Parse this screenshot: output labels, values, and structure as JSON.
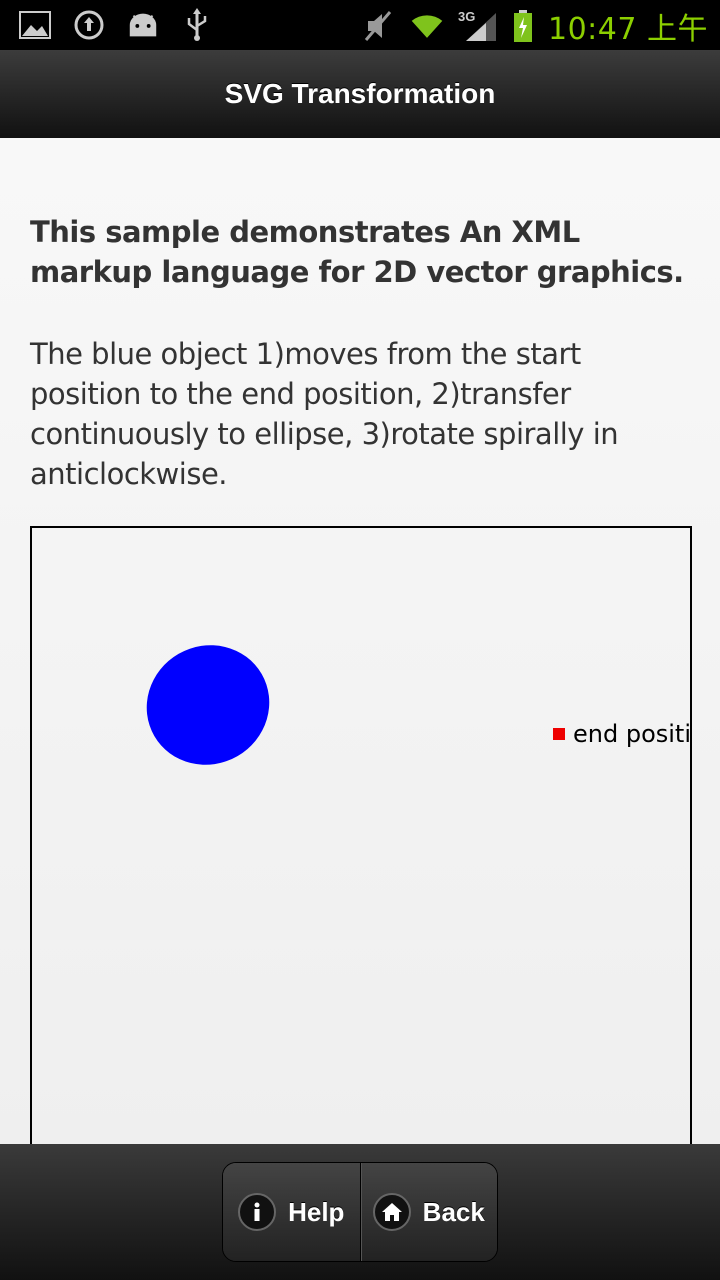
{
  "status_bar": {
    "icons": [
      "image-icon",
      "sync-icon",
      "android-icon",
      "usb-icon",
      "mute-icon",
      "wifi-icon",
      "signal-3g-icon",
      "battery-icon"
    ],
    "network": "3G",
    "time": "10:47 上午",
    "time_color": "#8ccf00"
  },
  "header": {
    "title": "SVG Transformation"
  },
  "content": {
    "intro": "This sample demonstrates An XML markup language for 2D vector graphics.",
    "description": "The blue object 1)moves from the start position to the end position, 2)transfer continuously to ellipse, 3)rotate spirally in anticlockwise.",
    "svg": {
      "end_label": "end position",
      "object_color": "#0000ff",
      "marker_color": "#ee0000"
    }
  },
  "footer": {
    "help_label": "Help",
    "back_label": "Back"
  }
}
